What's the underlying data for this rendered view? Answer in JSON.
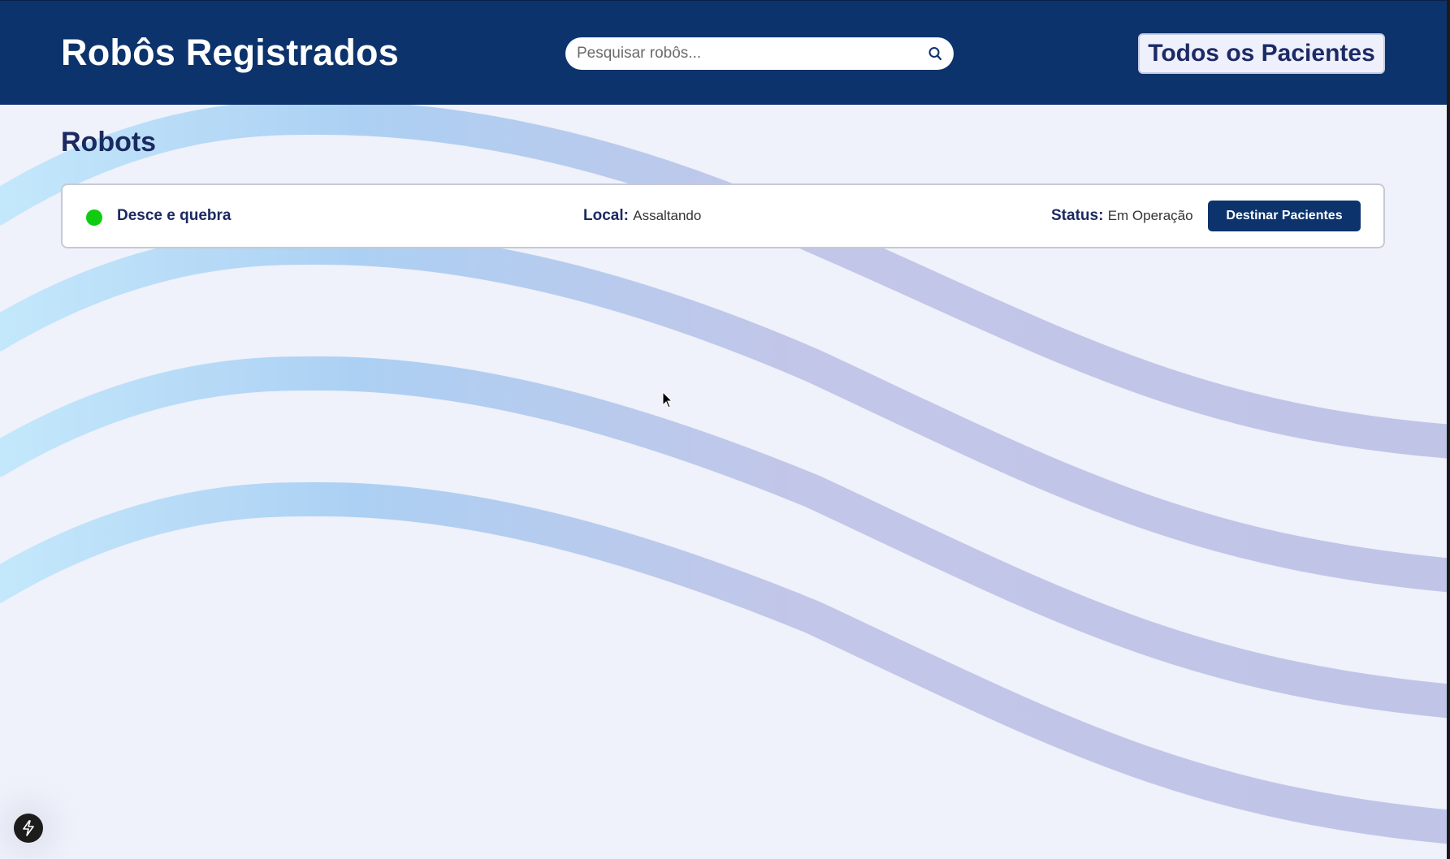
{
  "header": {
    "title": "Robôs Registrados",
    "search_placeholder": "Pesquisar robôs...",
    "search_icon": "search-icon",
    "all_patients_label": "Todos os Pacientes"
  },
  "section": {
    "title": "Robots"
  },
  "robots": [
    {
      "name": "Desce e quebra",
      "local_label": "Local:",
      "local_value": "Assaltando",
      "status_label": "Status:",
      "status_value": "Em Operação",
      "action_label": "Destinar Pacientes",
      "indicator_color": "#10cc10"
    }
  ],
  "colors": {
    "header_bg": "#0c336c",
    "page_bg": "#eff1fb",
    "accent": "#1b2a60"
  },
  "dev_badge_icon": "lightning-icon"
}
